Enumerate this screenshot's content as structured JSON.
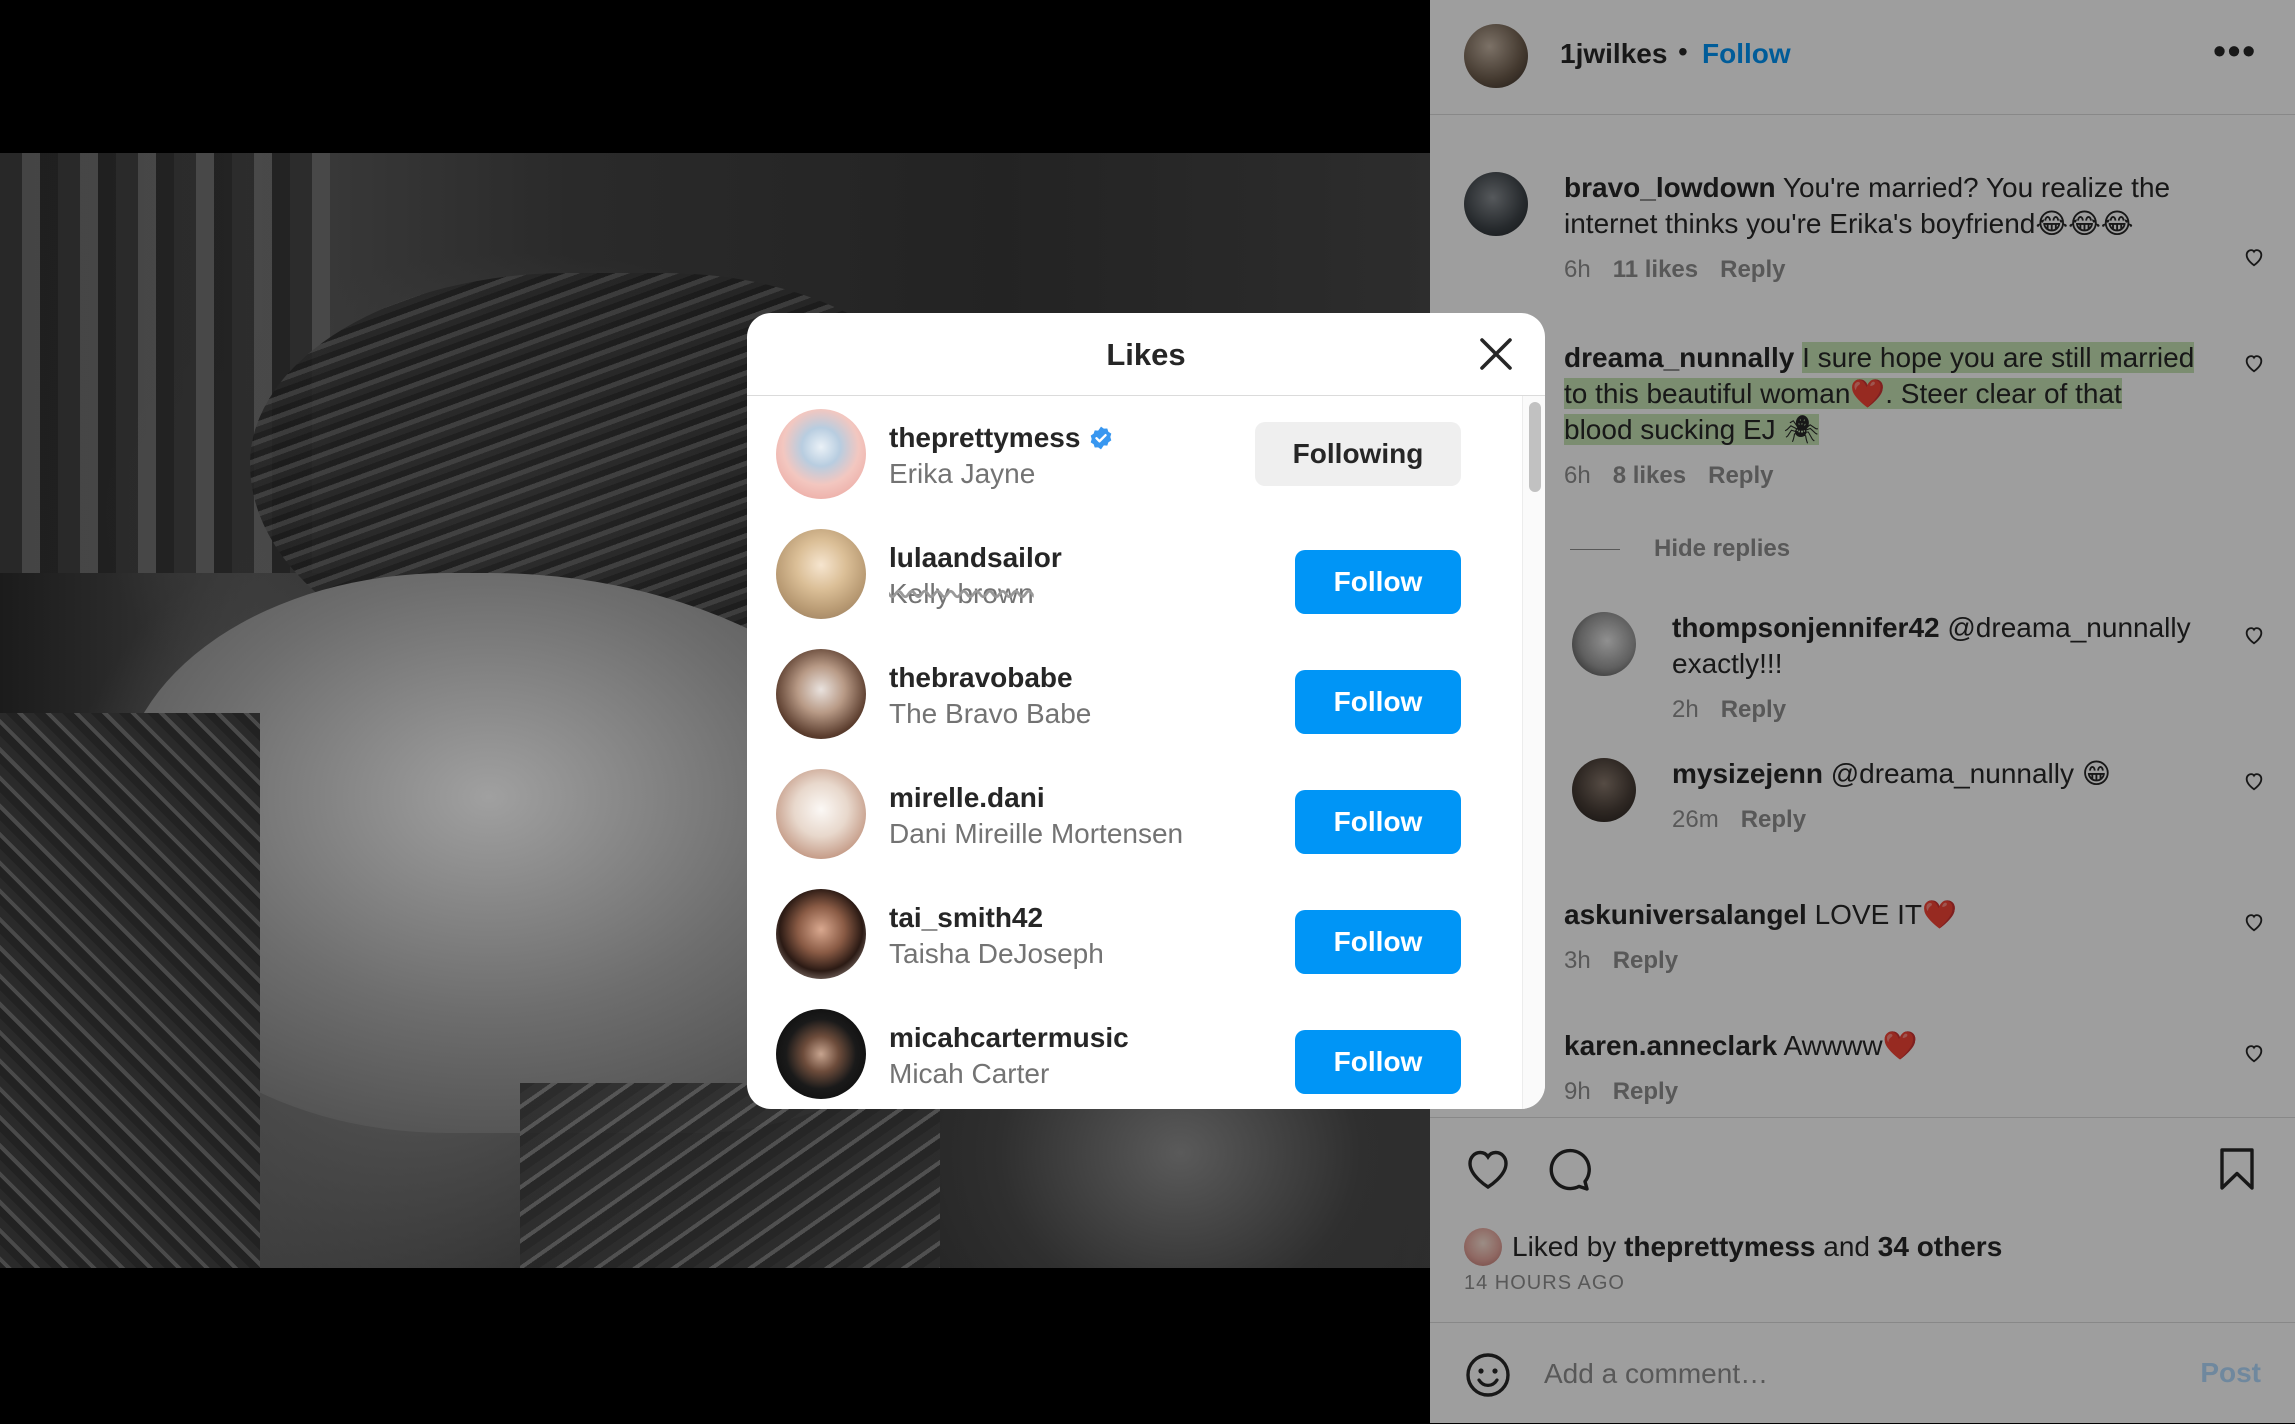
{
  "post_header": {
    "username": "1jwilkes",
    "separator": "•",
    "follow_label": "Follow",
    "more_label": "•••"
  },
  "comments": [
    {
      "user": "bravo_lowdown",
      "text": "You're married? You realize the",
      "text2": "internet thinks you're Erika's boyfriend😂😂😂",
      "time": "6h",
      "likes": "11 likes",
      "reply": "Reply"
    },
    {
      "user": "dreama_nunnally",
      "text": "I sure hope you are still married",
      "text2": "to this beautiful woman❤️. Steer clear of that",
      "text3": "blood sucking EJ 🕷",
      "time": "6h",
      "likes": "8 likes",
      "reply": "Reply"
    },
    {
      "user": "thompsonjennifer42",
      "text": "@dreama_nunnally",
      "text2": "exactly!!!",
      "time": "2h",
      "reply": "Reply"
    },
    {
      "user": "mysizejenn",
      "text": "@dreama_nunnally 😁",
      "time": "26m",
      "reply": "Reply"
    },
    {
      "user": "askuniversalangel",
      "text": "LOVE IT❤️",
      "time": "3h",
      "reply": "Reply"
    },
    {
      "user": "karen.anneclark",
      "text": "Awwww❤️",
      "time": "9h",
      "reply": "Reply"
    }
  ],
  "hide_replies": "Hide replies",
  "liked_by": {
    "prefix": "Liked by",
    "user": "theprettymess",
    "and": "and",
    "others": "34 others"
  },
  "time_ago": "14 HOURS AGO",
  "comment_bar": {
    "placeholder": "Add a comment…",
    "post_label": "Post"
  },
  "modal": {
    "title": "Likes",
    "rows": [
      {
        "username": "theprettymess",
        "name": "Erika Jayne",
        "verified": true,
        "button": "Following"
      },
      {
        "username": "lulaandsailor",
        "name": "Kelly brown",
        "button": "Follow"
      },
      {
        "username": "thebravobabe",
        "name": "The Bravo Babe",
        "button": "Follow"
      },
      {
        "username": "mirelle.dani",
        "name": "Dani Mireille Mortensen",
        "button": "Follow"
      },
      {
        "username": "tai_smith42",
        "name": "Taisha DeJoseph",
        "button": "Follow"
      },
      {
        "username": "micahcartermusic",
        "name": "Micah Carter",
        "button": "Follow"
      }
    ]
  },
  "colors": {
    "accent": "#0095f6",
    "highlight": "#c7e3b5",
    "following_bg": "#efefef"
  },
  "icons": [
    "close-icon",
    "verified-icon",
    "heart-icon",
    "comment-icon",
    "bookmark-icon",
    "emoji-icon",
    "more-icon"
  ]
}
